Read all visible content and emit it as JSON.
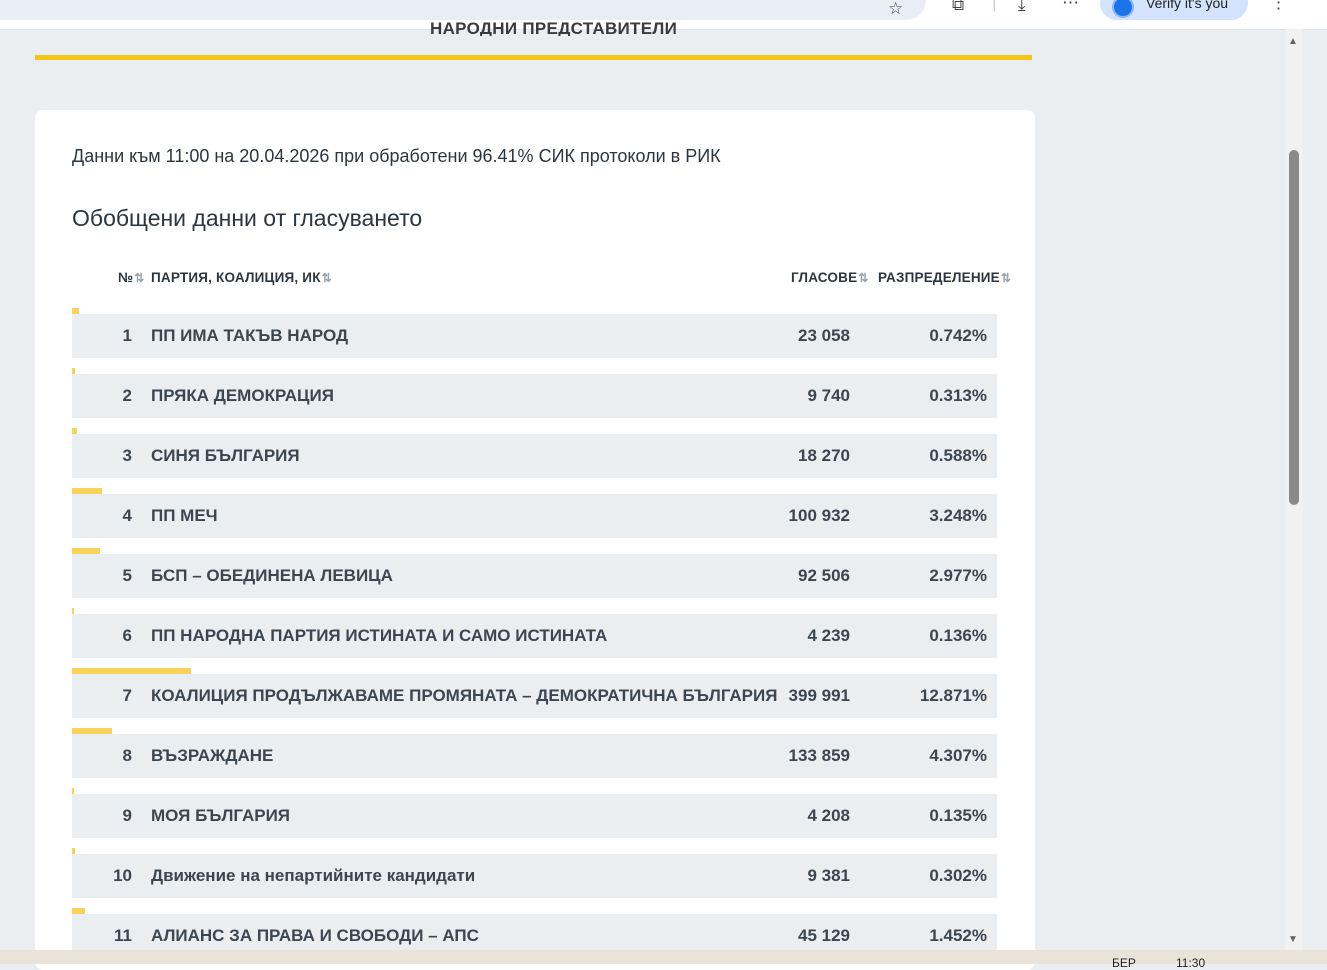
{
  "browser": {
    "verify_label": "Verify it's you",
    "icons": [
      "star-icon",
      "extensions-icon",
      "download-icon",
      "media-icon",
      "menu-icon"
    ]
  },
  "page": {
    "heading": "НАРОДНИ ПРЕДСТАВИТЕЛИ",
    "status": "Данни към 11:00 на 20.04.2026 при обработени 96.41% СИК протоколи в РИК",
    "summary_title": "Обобщени данни от гласуването",
    "columns": {
      "num": "№",
      "party": "ПАРТИЯ, КОАЛИЦИЯ, ИК",
      "votes": "ГЛАСОВЕ",
      "share": "РАЗПРЕДЕЛЕНИЕ"
    },
    "rows": [
      {
        "num": "1",
        "name": "ПП ИМА ТАКЪВ НАРОД",
        "votes": "23 058",
        "share": "0.742%",
        "share_value": 0.742
      },
      {
        "num": "2",
        "name": "ПРЯКА ДЕМОКРАЦИЯ",
        "votes": "9 740",
        "share": "0.313%",
        "share_value": 0.313
      },
      {
        "num": "3",
        "name": "СИНЯ БЪЛГАРИЯ",
        "votes": "18 270",
        "share": "0.588%",
        "share_value": 0.588
      },
      {
        "num": "4",
        "name": "ПП МЕЧ",
        "votes": "100 932",
        "share": "3.248%",
        "share_value": 3.248
      },
      {
        "num": "5",
        "name": "БСП – ОБЕДИНЕНА ЛЕВИЦА",
        "votes": "92 506",
        "share": "2.977%",
        "share_value": 2.977
      },
      {
        "num": "6",
        "name": "ПП НАРОДНА ПАРТИЯ ИСТИНАТА И САМО ИСТИНАТА",
        "votes": "4 239",
        "share": "0.136%",
        "share_value": 0.136
      },
      {
        "num": "7",
        "name": "КОАЛИЦИЯ ПРОДЪЛЖАВАМЕ ПРОМЯНАТА – ДЕМОКРАТИЧНА БЪЛГАРИЯ",
        "votes": "399 991",
        "share": "12.871%",
        "share_value": 12.871
      },
      {
        "num": "8",
        "name": "ВЪЗРАЖДАНЕ",
        "votes": "133 859",
        "share": "4.307%",
        "share_value": 4.307
      },
      {
        "num": "9",
        "name": "МОЯ БЪЛГАРИЯ",
        "votes": "4 208",
        "share": "0.135%",
        "share_value": 0.135
      },
      {
        "num": "10",
        "name": "Движение на непартийните кандидати",
        "votes": "9 381",
        "share": "0.302%",
        "share_value": 0.302
      },
      {
        "num": "11",
        "name": "АЛИАНС ЗА ПРАВА И СВОБОДИ – АПС",
        "votes": "45 129",
        "share": "1.452%",
        "share_value": 1.452
      }
    ]
  },
  "taskbar": {
    "lang": "БЕР",
    "time": "11:30"
  },
  "colors": {
    "accent": "#f5c518",
    "bar": "#f8d35a",
    "row_bg": "#ebeef1",
    "page_bg": "#ebeef1"
  }
}
